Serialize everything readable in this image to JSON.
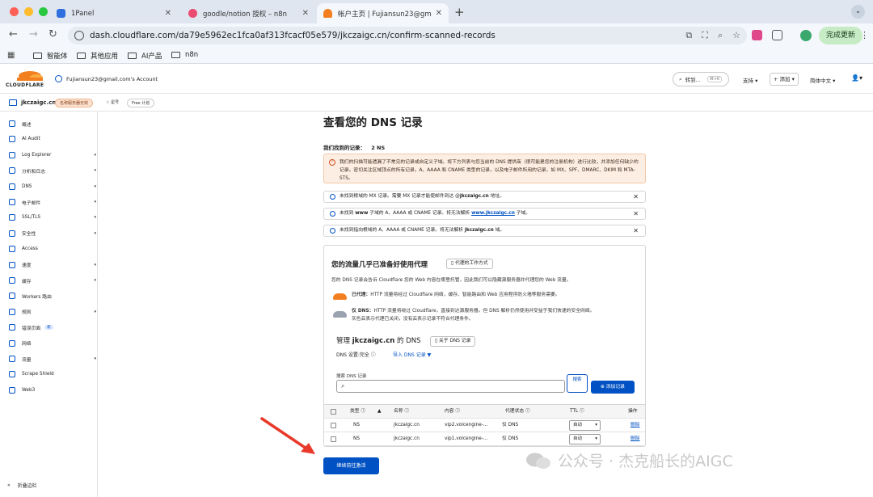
{
  "browser": {
    "tabs": [
      {
        "title": "1Panel",
        "icon_color": "#2f6fde"
      },
      {
        "title": "goodle/notion 授权 – n8n",
        "icon_color": "#ea4b71"
      },
      {
        "title": "帐户主页 | Fujiansun23@gmail",
        "icon_color": "#f38020"
      }
    ],
    "url": "dash.cloudflare.com/da79e5962ec1fca0af313fcacf05e579/jkczaigc.cn/confirm-scanned-records",
    "update_label": "完成更新",
    "bookmarks": [
      "智能体",
      "其他应用",
      "AI产品",
      "n8n"
    ]
  },
  "header": {
    "logo_text": "CLOUDFLARE",
    "account": "Fujiansun23@gmail.com's Account",
    "goto_placeholder": "转到...",
    "goto_shortcut": "⌘+K",
    "support": "支持",
    "add": "+ 添加",
    "language": "简体中文"
  },
  "zone": {
    "name": "jkczaigc.cn",
    "status_badge": "名称服务器无效",
    "star_label": "☆ 星号",
    "plan_badge": "Free 计划"
  },
  "sidebar": {
    "items": [
      {
        "label": "概述",
        "caret": false
      },
      {
        "label": "AI Audit",
        "caret": false
      },
      {
        "label": "Log Explorer",
        "caret": true
      },
      {
        "label": "分析和日志",
        "caret": true
      },
      {
        "label": "DNS",
        "caret": true
      },
      {
        "label": "电子邮件",
        "caret": true
      },
      {
        "label": "SSL/TLS",
        "caret": true
      },
      {
        "label": "安全性",
        "caret": true
      },
      {
        "label": "Access",
        "caret": false
      },
      {
        "label": "速度",
        "caret": true
      },
      {
        "label": "缓存",
        "caret": true
      },
      {
        "label": "Workers 路由",
        "caret": false
      },
      {
        "label": "规则",
        "caret": true
      },
      {
        "label": "错误页面",
        "caret": false,
        "badge": "新"
      },
      {
        "label": "网络",
        "caret": false
      },
      {
        "label": "流量",
        "caret": true
      },
      {
        "label": "Scrape Shield",
        "caret": false
      },
      {
        "label": "Web3",
        "caret": false
      }
    ],
    "collapse_label": "折叠边栏"
  },
  "main": {
    "title": "查看您的 DNS 记录",
    "found_label": "我们找到的记录：",
    "found_count": "2 NS",
    "warning": "我们的扫描可能遗漏了不常见的记录或自定义子域。将下方列表与您当前的 DNS 提供商（很可能是您的注册机构）进行比较，并添加任何缺少的记录。密切关注区域顶点的所有记录。A、AAAA 和 CNAME 类型的记录，以及电子邮件所用的记录，如 MX、SPF、DMARC、DKIM 和 MTA-STS。",
    "notices": [
      {
        "pre": "未找到根域的 MX 记录。需要 MX 记录才能使邮件到达 @",
        "bold": "jkczaigc.cn",
        "post": " 地址。",
        "link": false
      },
      {
        "pre": "未找到 ",
        "bold": "www",
        "post": " 子域的 A、AAAA 或 CNAME 记录。将无法解析 ",
        "link_text": "www.jkczaigc.cn",
        "post2": " 子域。",
        "link": true
      },
      {
        "pre": "未找到指向根域的 A、AAAA 或 CNAME 记录。将无法解析 ",
        "bold": "jkczaigc.cn",
        "post": " 域。",
        "link": false
      }
    ],
    "proxy": {
      "title": "您的流量几乎已准备好使用代理",
      "how_button": "代理的工作方式",
      "desc": "您的 DNS 记录会告诉 Cloudflare 您的 Web 内容在哪里托管，因此我们可以隐藏源服务器并代理您的 Web 流量。",
      "proxied_label": "已代理：",
      "proxied_text": "HTTP 流量将经过 Cloudflare 网络，缓存、智能路由和 Web 应用程序防火墙等服务需要。",
      "dns_only_label": "仅 DNS：",
      "dns_only_text1": "HTTP 流量将绕过 Cloudflare，直接到达源服务器。但 DNS 解析仍然使用并受益于我们快速的安全网络。",
      "dns_only_text2": "灰色云表示代理已关闭，没有云表示记录不符合代理条件。",
      "orange": "#f38020",
      "gray": "#9aa3ad"
    },
    "manage": {
      "title_pre": "管理 ",
      "title_bold": "jkczaigc.cn",
      "title_post": " 的 DNS",
      "about_button": "关于 DNS 记录",
      "setting_label": "DNS 设置:完全 ⓘ",
      "import_label": "导入 DNS 记录 ▼",
      "search_label": "搜索 DNS 记录",
      "search_button": "搜索",
      "add_button": "添加记录"
    },
    "table": {
      "headers": {
        "type": "类型 ⓘ",
        "name": "名称 ⓘ",
        "content": "内容 ⓘ",
        "proxy": "代理状态 ⓘ",
        "ttl": "TTL ⓘ",
        "actions": "操作"
      },
      "rows": [
        {
          "type": "NS",
          "name": "jkczaigc.cn",
          "content": "vip2.volcengine-...",
          "proxy": "仅 DNS",
          "ttl": "自动",
          "action": "删除"
        },
        {
          "type": "NS",
          "name": "jkczaigc.cn",
          "content": "vip1.volcengine-...",
          "proxy": "仅 DNS",
          "ttl": "自动",
          "action": "删除"
        }
      ]
    },
    "continue_button": "继续前往激活"
  },
  "watermark": "公众号 · 杰克船长的AIGC",
  "colors": {
    "accent": "#0051c3",
    "cf_orange": "#f38020",
    "arrow": "#e8392a"
  }
}
